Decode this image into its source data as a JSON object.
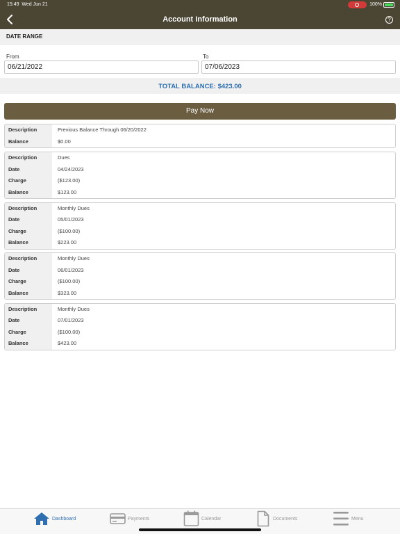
{
  "status_bar": {
    "time": "15:49",
    "date": "Wed Jun 21",
    "battery": "100%"
  },
  "header": {
    "title": "Account Information",
    "help_label": "?"
  },
  "date_range": {
    "label": "DATE RANGE",
    "from_label": "From",
    "from_value": "06/21/2022",
    "to_label": "To",
    "to_value": "07/06/2023"
  },
  "total_balance": "TOTAL BALANCE: $423.00",
  "pay_button": "Pay Now",
  "labels": {
    "description": "Description",
    "date": "Date",
    "charge": "Charge",
    "balance": "Balance"
  },
  "transactions": [
    {
      "description": "Previous Balance Through 06/20/2022",
      "balance": "$0.00"
    },
    {
      "description": "Dues",
      "date": "04/24/2023",
      "charge": "($123.00)",
      "balance": "$123.00"
    },
    {
      "description": "Monthly Dues",
      "date": "05/01/2023",
      "charge": "($100.00)",
      "balance": "$223.00"
    },
    {
      "description": "Monthly Dues",
      "date": "06/01/2023",
      "charge": "($100.00)",
      "balance": "$323.00"
    },
    {
      "description": "Monthly Dues",
      "date": "07/01/2023",
      "charge": "($100.00)",
      "balance": "$423.00"
    }
  ],
  "tabs": [
    {
      "label": "Dashboard",
      "icon": "home-icon",
      "active": true
    },
    {
      "label": "Payments",
      "icon": "credit-card-icon"
    },
    {
      "label": "Calendar",
      "icon": "calendar-icon"
    },
    {
      "label": "Documents",
      "icon": "document-icon"
    },
    {
      "label": "Menu",
      "icon": "menu-icon"
    }
  ],
  "colors": {
    "header": "#4b4633",
    "pay_button": "#6a5d40",
    "accent": "#2f6fb0"
  }
}
